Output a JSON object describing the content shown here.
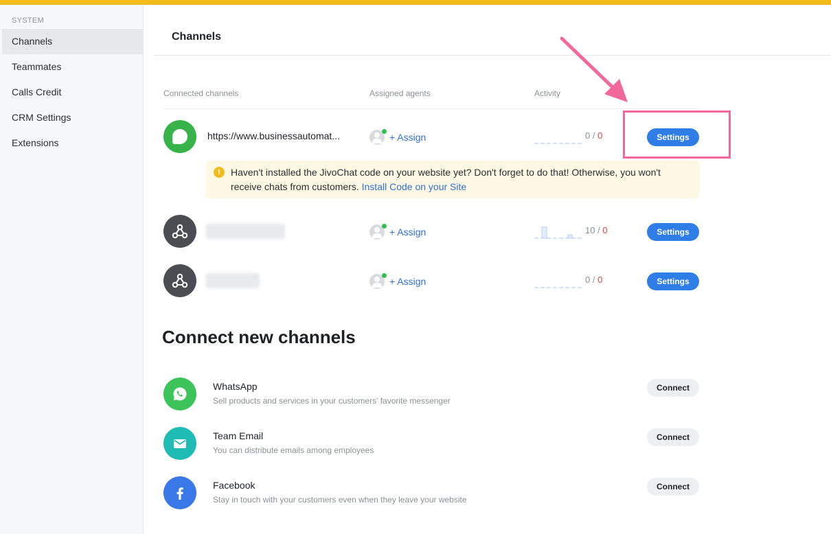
{
  "sidebar": {
    "section_label": "SYSTEM",
    "items": [
      {
        "label": "Channels",
        "active": true
      },
      {
        "label": "Teammates"
      },
      {
        "label": "Calls Credit"
      },
      {
        "label": "CRM Settings"
      },
      {
        "label": "Extensions"
      }
    ]
  },
  "main": {
    "title": "Channels",
    "columns": {
      "channels": "Connected channels",
      "agents": "Assigned agents",
      "activity": "Activity"
    },
    "connected": [
      {
        "icon": "jivochat-bubble-icon",
        "name": "https://www.businessautomat...",
        "assign_label": "+ Assign",
        "activity_total": "0",
        "activity_missed": "0",
        "activity_sep": "/",
        "settings_label": "Settings"
      },
      {
        "icon": "webhook-icon",
        "name": "",
        "assign_label": "+ Assign",
        "activity_total": "10",
        "activity_missed": "0",
        "activity_sep": "/",
        "settings_label": "Settings"
      },
      {
        "icon": "webhook-icon",
        "name": "",
        "assign_label": "+ Assign",
        "activity_total": "0",
        "activity_missed": "0",
        "activity_sep": "/",
        "settings_label": "Settings"
      }
    ],
    "warning": {
      "text": "Haven't installed the JivoChat code on your website yet? Don't forget to do that! Otherwise, you won't receive chats from customers.",
      "link": "Install Code on your Site",
      "icon": "exclamation-icon"
    },
    "connect_section": {
      "title": "Connect new channels",
      "items": [
        {
          "title": "WhatsApp",
          "desc": "Sell products and services in your customers' favorite messenger",
          "button": "Connect",
          "icon": "whatsapp-icon",
          "color": "#3cc35a"
        },
        {
          "title": "Team Email",
          "desc": "You can distribute emails among employees",
          "button": "Connect",
          "icon": "email-icon",
          "color": "#1fbcb5"
        },
        {
          "title": "Facebook",
          "desc": "Stay in touch with your customers even when they leave your website",
          "button": "Connect",
          "icon": "facebook-icon",
          "color": "#3b78e7"
        }
      ]
    }
  },
  "colors": {
    "topbar": "#f3bc1c",
    "primary_button": "#2f7ee8",
    "link": "#2f6fd6",
    "highlight": "#f0699a"
  }
}
